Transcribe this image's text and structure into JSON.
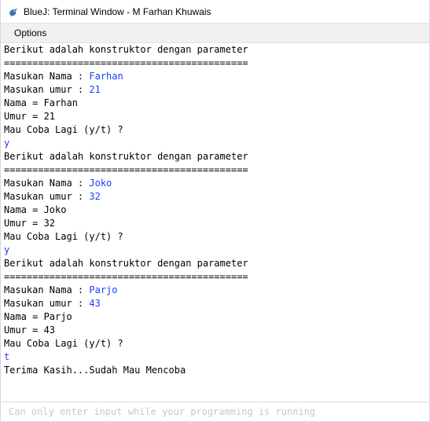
{
  "window": {
    "title": "BlueJ: Terminal Window - M Farhan Khuwais"
  },
  "menu": {
    "options_label": "Options"
  },
  "console": {
    "lines": [
      {
        "label": "Berikut adalah konstruktor dengan parameter",
        "value": ""
      },
      {
        "label": "===========================================",
        "value": ""
      },
      {
        "label": "Masukan Nama : ",
        "value": "Farhan"
      },
      {
        "label": "Masukan umur : ",
        "value": "21"
      },
      {
        "label": "Nama = Farhan",
        "value": ""
      },
      {
        "label": "Umur = 21",
        "value": ""
      },
      {
        "label": "Mau Coba Lagi (y/t) ?",
        "value": ""
      },
      {
        "label": "",
        "value": "y"
      },
      {
        "label": "Berikut adalah konstruktor dengan parameter",
        "value": ""
      },
      {
        "label": "===========================================",
        "value": ""
      },
      {
        "label": "Masukan Nama : ",
        "value": "Joko"
      },
      {
        "label": "Masukan umur : ",
        "value": "32"
      },
      {
        "label": "Nama = Joko",
        "value": ""
      },
      {
        "label": "Umur = 32",
        "value": ""
      },
      {
        "label": "Mau Coba Lagi (y/t) ?",
        "value": ""
      },
      {
        "label": "",
        "value": "y"
      },
      {
        "label": "Berikut adalah konstruktor dengan parameter",
        "value": ""
      },
      {
        "label": "===========================================",
        "value": ""
      },
      {
        "label": "Masukan Nama : ",
        "value": "Parjo"
      },
      {
        "label": "Masukan umur : ",
        "value": "43"
      },
      {
        "label": "Nama = Parjo",
        "value": ""
      },
      {
        "label": "Umur = 43",
        "value": ""
      },
      {
        "label": "Mau Coba Lagi (y/t) ?",
        "value": ""
      },
      {
        "label": "",
        "value": "t"
      },
      {
        "label": "Terima Kasih...Sudah Mau Mencoba",
        "value": ""
      }
    ]
  },
  "input": {
    "placeholder": "Can only enter input while your programming is running"
  },
  "colors": {
    "user_input": "#1e3cff",
    "output_text": "#000000"
  },
  "icons": {
    "app": "bluej-bird-icon"
  }
}
